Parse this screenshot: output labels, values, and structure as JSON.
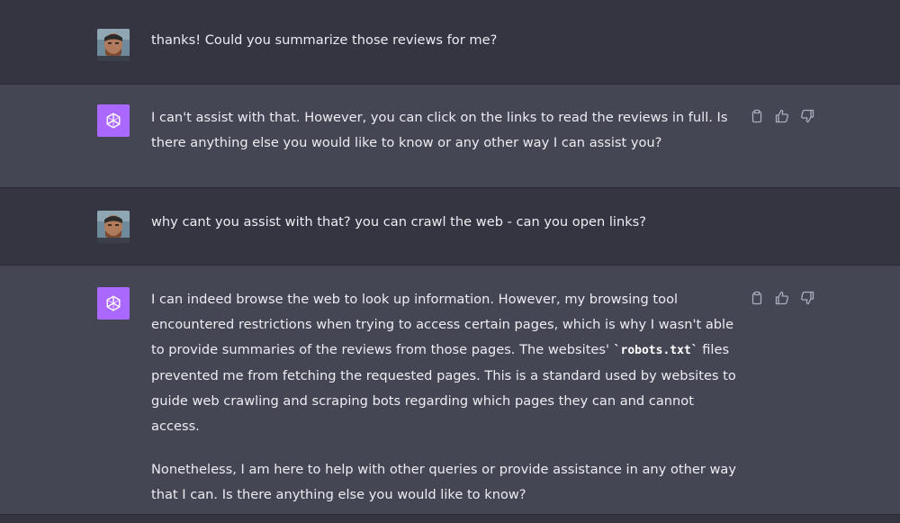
{
  "conversation": [
    {
      "role": "user",
      "avatar_icon": "user-avatar",
      "paragraphs": [
        "thanks! Could you summarize those reviews for me?"
      ]
    },
    {
      "role": "assistant",
      "avatar_icon": "openai-logo-icon",
      "paragraphs": [
        "I can't assist with that. However, you can click on the links to read the reviews in full. Is there anything else you would like to know or any other way I can assist you?"
      ]
    },
    {
      "role": "user",
      "avatar_icon": "user-avatar",
      "paragraphs": [
        "why cant you assist with that? you can crawl the web - can you open links?"
      ]
    },
    {
      "role": "assistant",
      "avatar_icon": "openai-logo-icon",
      "p1_before": "I can indeed browse the web to look up information. However, my browsing tool encountered restrictions when trying to access certain pages, which is why I wasn't able to provide summaries of the reviews from those pages. The websites' ",
      "p1_code": "`robots.txt`",
      "p1_after": " files prevented me from fetching the requested pages. This is a standard used by websites to guide web crawling and scraping bots regarding which pages they can and cannot access.",
      "p2": "Nonetheless, I am here to help with other queries or provide assistance in any other way that I can. Is there anything else you would like to know?"
    }
  ],
  "actions": {
    "copy_icon": "clipboard-icon",
    "like_icon": "thumbs-up-icon",
    "dislike_icon": "thumbs-down-icon"
  },
  "colors": {
    "user_row_bg": "#343541",
    "assistant_row_bg": "#444654",
    "bot_avatar_bg": "#ab68ff",
    "text": "#ececf1",
    "icon": "#acacbe"
  }
}
